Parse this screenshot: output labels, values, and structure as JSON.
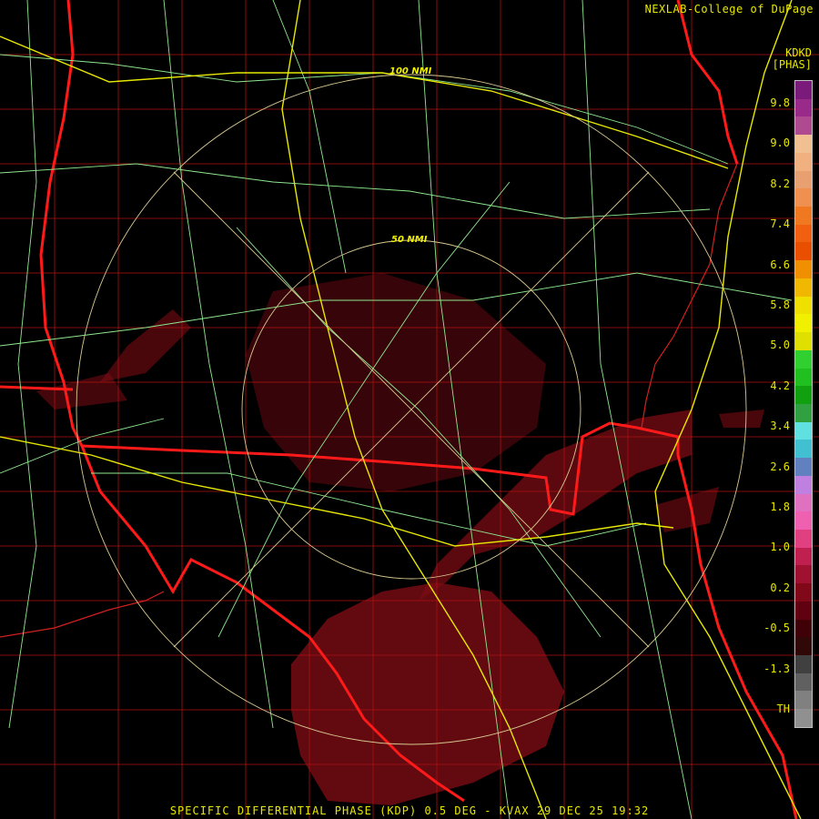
{
  "header": {
    "credit": "NEXLAB-College of DuPage",
    "product_code": "KDKD",
    "product_unit": "[PHAS]"
  },
  "range_rings": [
    {
      "label": "100 NMI"
    },
    {
      "label": "50 NMI"
    }
  ],
  "footer": {
    "caption": "SPECIFIC DIFFERENTIAL PHASE (KDP) 0.5 DEG - KVAX 29 DEC 25 19:32"
  },
  "legend": {
    "ticks": [
      "9.8",
      "9.0",
      "8.2",
      "7.4",
      "6.6",
      "5.8",
      "5.0",
      "4.2",
      "3.4",
      "2.6",
      "1.8",
      "1.0",
      "0.2",
      "-0.5",
      "-1.3",
      "TH"
    ],
    "colors": [
      "#7a1a7a",
      "#9a2a8a",
      "#b04a90",
      "#f0c090",
      "#f0b080",
      "#e8a070",
      "#f09050",
      "#f07820",
      "#f06010",
      "#e85000",
      "#f09000",
      "#f0b800",
      "#f0e000",
      "#f0f000",
      "#e0e000",
      "#30d030",
      "#20c020",
      "#10a010",
      "#30a040",
      "#60e0e0",
      "#40c0d0",
      "#6080c0",
      "#c080e0",
      "#e070c0",
      "#f060b0",
      "#e04080",
      "#c02050",
      "#a01030",
      "#800818",
      "#600010",
      "#400008",
      "#300808",
      "#404040",
      "#606060",
      "#808080",
      "#909090"
    ]
  },
  "colors": {
    "state_border": "#ff1a1a",
    "county_border": "#b01010",
    "highway": "#e8e800",
    "road": "#90e890",
    "ring": "#d8c890",
    "echo": "#7a0c14"
  }
}
